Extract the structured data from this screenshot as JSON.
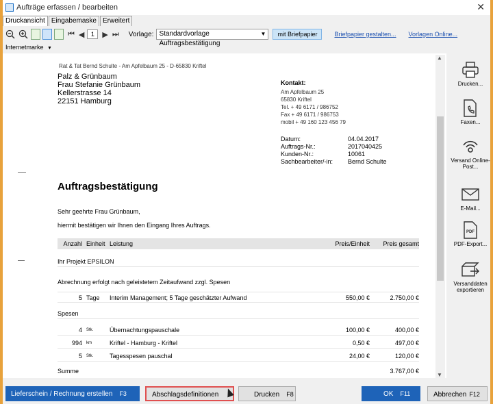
{
  "window": {
    "title": "Aufträge erfassen / bearbeiten",
    "close_glyph": "✕"
  },
  "tabs": [
    "Druckansicht",
    "Eingabemaske",
    "Erweitert"
  ],
  "toolbar": {
    "page_number": "1",
    "vorlage_label": "Vorlage:",
    "vorlage_value": "Standardvorlage Auftragsbestätigung",
    "briefpapier_button": "mit Briefpapier",
    "link_briefpapier": "Briefpapier gestalten...",
    "link_vorlagen": "Vorlagen Online..."
  },
  "internetmarke": "Internetmarke",
  "document": {
    "sender_line": "Rat & Tat Bernd Schulte - Am Apfelbaum 25 - D-65830 Kriftel",
    "recipient": [
      "Palz & Grünbaum",
      "Frau Stefanie Grünbaum",
      "Kellerstrasse 14",
      "22151 Hamburg"
    ],
    "kontakt": {
      "heading": "Kontakt:",
      "lines": [
        "Am Apfelbaum 25",
        "65830 Kriftel",
        "Tel. + 49 6171 / 986752",
        "Fax + 49 6171 / 986753",
        "mobil + 49 160 123 456 79"
      ]
    },
    "meta": [
      {
        "key": "Datum:",
        "value": "04.04.2017"
      },
      {
        "key": "Auftrags-Nr.:",
        "value": "2017040425"
      },
      {
        "key": "Kunden-Nr.:",
        "value": "10061"
      },
      {
        "key": "Sachbearbeiter/-in:",
        "value": "Bernd Schulte"
      }
    ],
    "heading": "Auftragsbestätigung",
    "salutation": "Sehr geehrte Frau Grünbaum,",
    "intro": "hiermit bestätigen wir Ihnen den Eingang Ihres Auftrags.",
    "table_headers": {
      "anzahl": "Anzahl",
      "einheit": "Einheit",
      "leistung": "Leistung",
      "preis": "Preis/Einheit",
      "gesamt": "Preis gesamt"
    },
    "project": "Ihr Projekt EPSILON",
    "abrechnung": "Abrechnung erfolgt nach geleistetem Zeitaufwand zzgl. Spesen",
    "row_main": {
      "anzahl": "5",
      "einheit": "Tage",
      "leistung": "Interim Management; 5 Tage geschätzter Aufwand",
      "preis": "550,00 €",
      "gesamt": "2.750,00 €"
    },
    "spesen_label": "Spesen",
    "spesen_rows": [
      {
        "anzahl": "4",
        "einheit": "Stk.",
        "leistung": "Übernachtungspauschale",
        "preis": "100,00 €",
        "gesamt": "400,00 €"
      },
      {
        "anzahl": "994",
        "einheit": "km",
        "leistung": "Kriftel - Hamburg - Kriftel",
        "preis": "0,50 €",
        "gesamt": "497,00 €"
      },
      {
        "anzahl": "5",
        "einheit": "Stk.",
        "leistung": "Tagesspesen pauschal",
        "preis": "24,00 €",
        "gesamt": "120,00 €"
      }
    ],
    "summe_label": "Summe",
    "summe_value": "3.767,00 €"
  },
  "right_panel": [
    {
      "label": "Drucken...",
      "icon": "printer-icon"
    },
    {
      "label": "Faxen...",
      "icon": "fax-icon"
    },
    {
      "label": "Versand Online-Post...",
      "icon": "online-post-icon"
    },
    {
      "label": "E-Mail...",
      "icon": "email-icon"
    },
    {
      "label": "PDF-Export...",
      "icon": "pdf-icon"
    },
    {
      "label": "Versanddaten exportieren",
      "icon": "export-icon"
    }
  ],
  "bottom_buttons": {
    "lieferschein": "Lieferschein / Rechnung erstellen",
    "lieferschein_key": "F3",
    "abschlag": "Abschlagsdefinitionen",
    "drucken": "Drucken",
    "drucken_key": "F8",
    "ok": "OK",
    "ok_key": "F11",
    "abbrechen": "Abbrechen",
    "abbrechen_key": "F12"
  }
}
